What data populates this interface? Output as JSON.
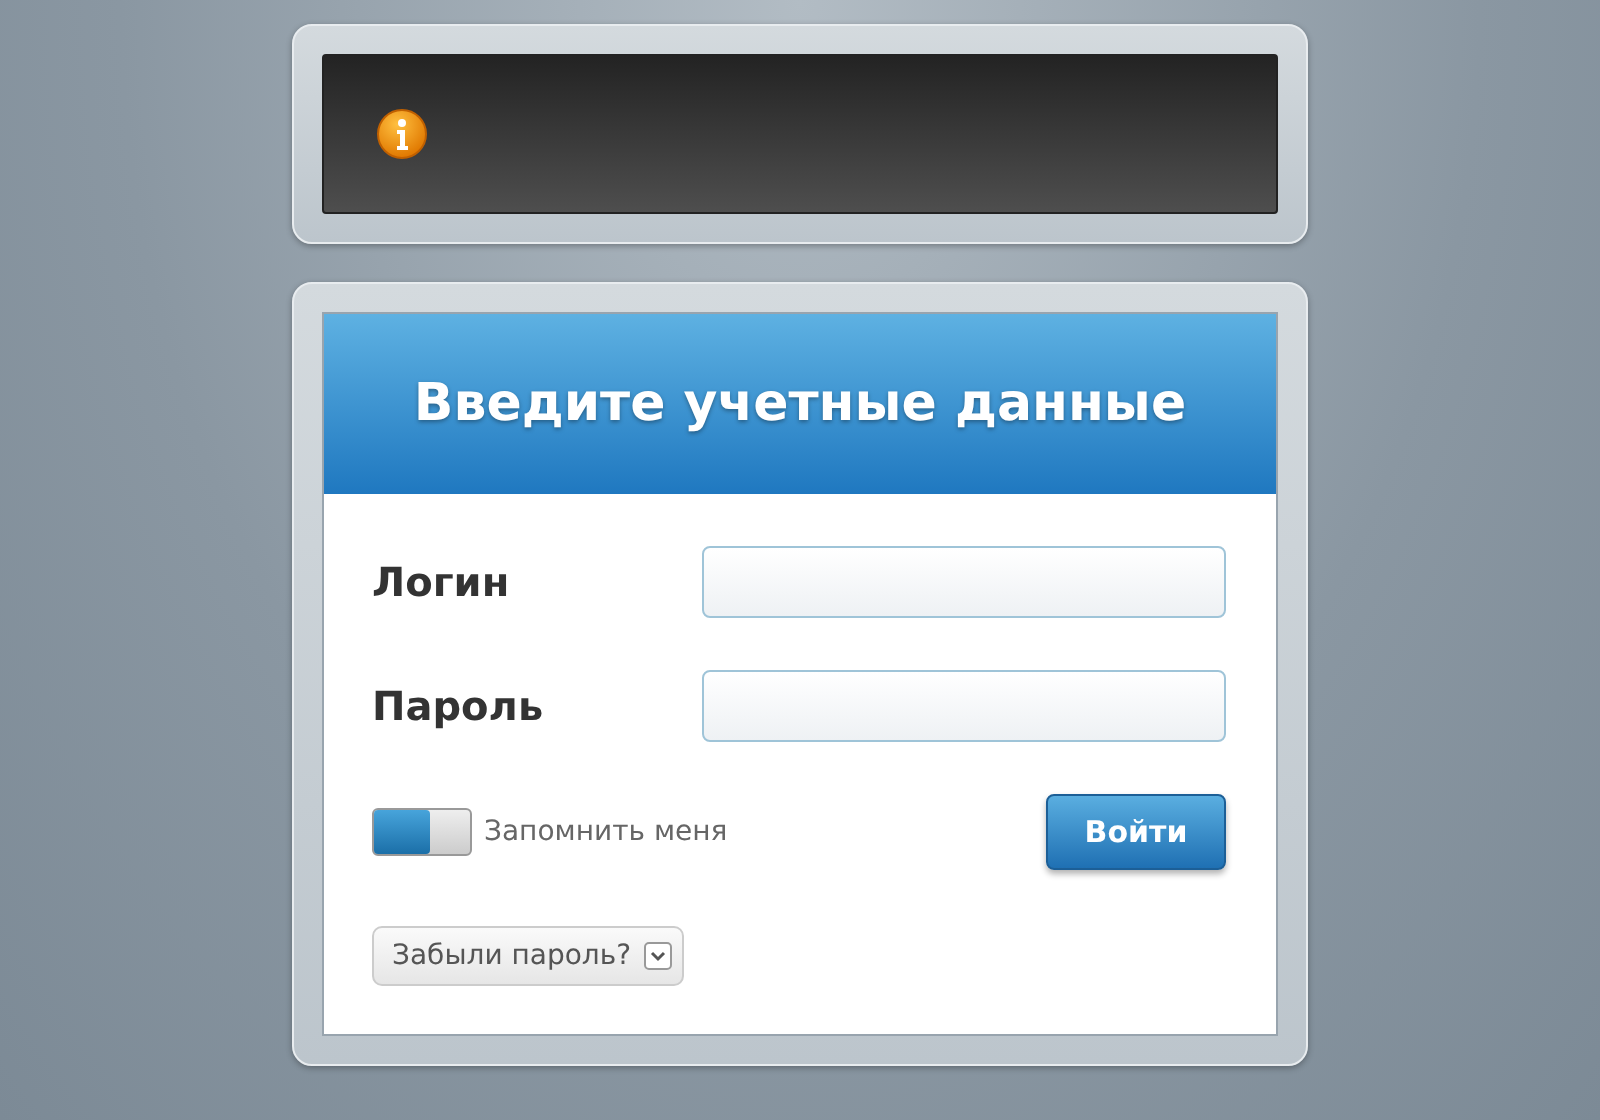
{
  "notice": {
    "kind": "info"
  },
  "login": {
    "title": "Введите учетные данные",
    "fields": [
      {
        "label": "Логин"
      },
      {
        "label": "Пароль"
      }
    ],
    "remember": {
      "label": "Запомнить меня",
      "on": false
    },
    "submit": "Войти",
    "forgot": {
      "label": "Забыли пароль?",
      "expanded": false
    }
  }
}
